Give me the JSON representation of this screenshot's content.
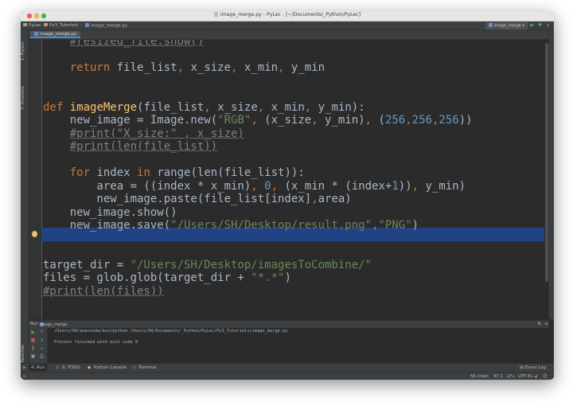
{
  "window": {
    "title": "image_merge.py - PyLec - [~/Documents/_Python/PyLec]"
  },
  "navbar": {
    "breadcrumbs": [
      "PyLec",
      "Py3_Tutorials",
      "image_merge.py"
    ],
    "run_config": "image_merge",
    "run_icon": "play-icon",
    "debug_icon": "debug-icon",
    "search_icon": "search-icon"
  },
  "left_tabs": [
    "1: Project",
    "7: Structure",
    "2: Favorites"
  ],
  "editor": {
    "tab_label": "image_merge.py",
    "lines": [
      "    #resized_file.show()",
      "",
      "    return file_list, x_size, x_min, y_min",
      "",
      "",
      "def imageMerge(file_list, x_size, x_min, y_min):",
      "    new_image = Image.new(\"RGB\", (x_size, y_min), (256,256,256))",
      "    #print(\"X_size:\" , x_size)",
      "    #print(len(file_list))",
      "",
      "    for index in range(len(file_list)):",
      "        area = ((index * x_min), 0, (x_min * (index+1)), y_min)",
      "        new_image.paste(file_list[index],area)",
      "    new_image.show()",
      "    new_image.save(\"/Users/SH/Desktop/result.png\",\"PNG\")",
      "",
      "",
      "target_dir = \"/Users/SH/Desktop/imagesToCombine/\"",
      "files = glob.glob(target_dir + \"*.*\")",
      "#print(len(files))"
    ],
    "highlighted_line": 15,
    "colors": {
      "background": "#2b2b2b",
      "keyword": "#cc7832",
      "function": "#ffc66d",
      "string": "#6a8759",
      "number": "#6897bb",
      "comment": "#808080",
      "text": "#a9b7c6",
      "selection": "#214283"
    }
  },
  "run_panel": {
    "label": "Run",
    "config": "image_merge",
    "command": "/Users/SH/anaconda/bin/python /Users/SH/Documents/_Python/PyLec/Py3_Tutorials/image_merge.py",
    "result": "Process finished with exit code 0"
  },
  "tool_windows": {
    "run": "4: Run",
    "todo": "6: TODO",
    "python_console": "Python Console",
    "terminal": "Terminal",
    "event_log": "Event Log"
  },
  "status": {
    "chars": "56 chars",
    "position": "47:1",
    "line_sep": "LF÷",
    "encoding": "UTF-8÷"
  }
}
